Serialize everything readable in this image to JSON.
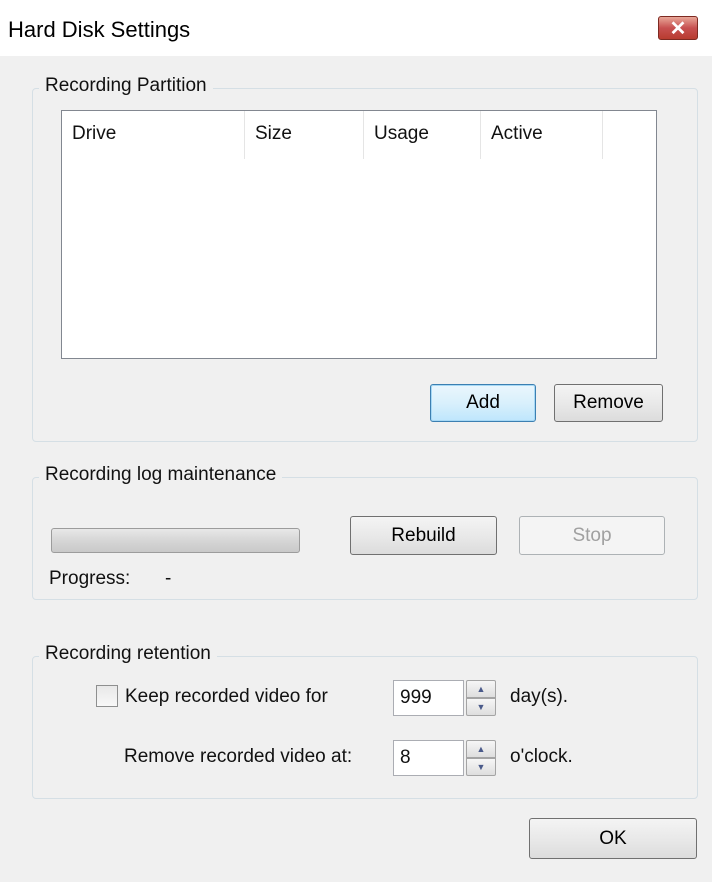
{
  "window": {
    "title": "Hard Disk Settings",
    "close_glyph": "✕"
  },
  "partition": {
    "legend": "Recording Partition",
    "columns": [
      "Drive",
      "Size",
      "Usage",
      "Active"
    ],
    "add_label": "Add",
    "remove_label": "Remove"
  },
  "log": {
    "legend": "Recording log maintenance",
    "rebuild_label": "Rebuild",
    "stop_label": "Stop",
    "progress_label": "Progress:",
    "progress_value": "-",
    "progress_fraction": 0
  },
  "retention": {
    "legend": "Recording retention",
    "keep_label": "Keep recorded video for",
    "keep_checked": false,
    "keep_value": "999",
    "keep_unit": "day(s).",
    "remove_label": "Remove recorded video at:",
    "remove_value": "8",
    "remove_unit": "o'clock."
  },
  "ok_label": "OK",
  "icons": {
    "spin_up": "▲",
    "spin_down": "▼"
  }
}
